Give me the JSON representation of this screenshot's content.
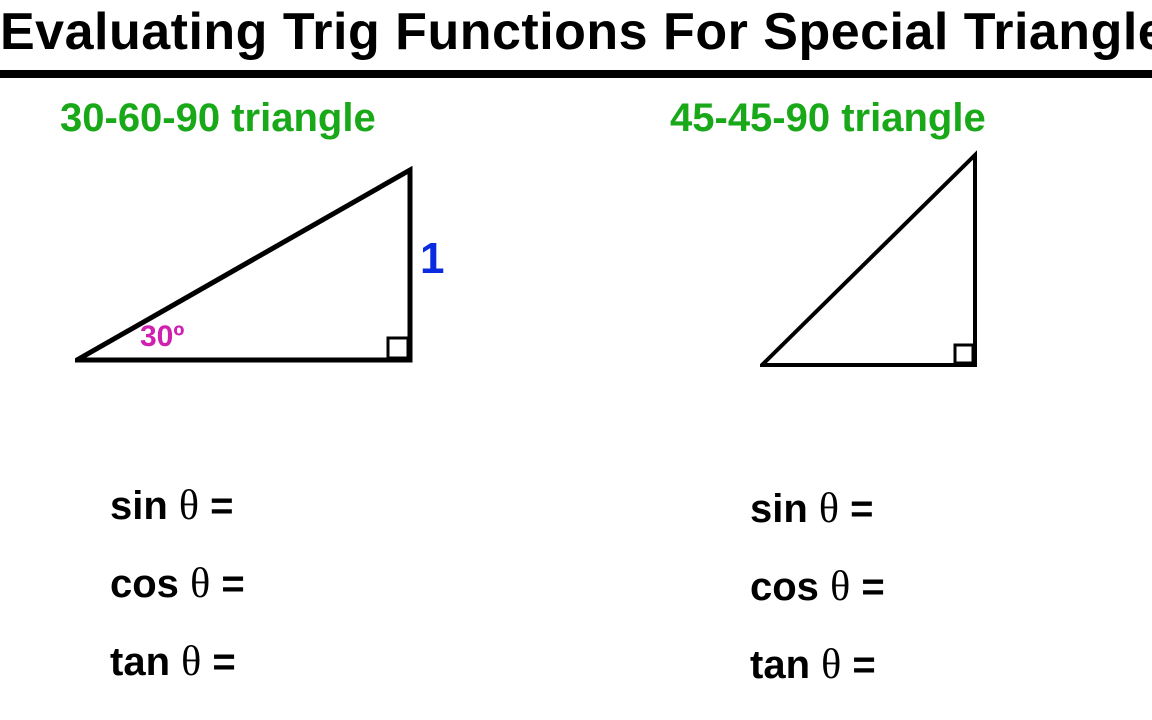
{
  "title": "Evaluating Trig Functions For Special Triangles",
  "left": {
    "heading": "30-60-90 triangle",
    "angle_label": "30º",
    "side_label": "1",
    "equations": {
      "sin": "sin",
      "cos": "cos",
      "tan": "tan",
      "theta": "θ",
      "eq": "="
    }
  },
  "right": {
    "heading": "45-45-90 triangle",
    "equations": {
      "sin": "sin",
      "cos": "cos",
      "tan": "tan",
      "theta": "θ",
      "eq": "="
    }
  }
}
